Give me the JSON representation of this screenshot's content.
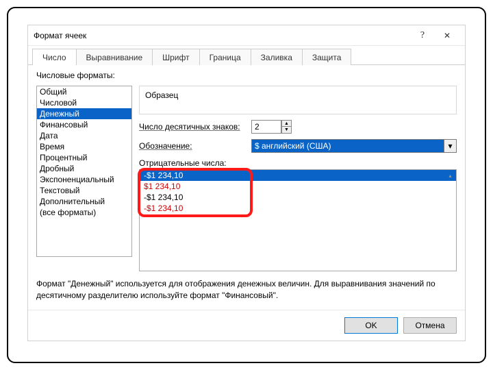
{
  "dialog": {
    "title": "Формат ячеек"
  },
  "tabs": [
    {
      "label": "Число",
      "active": true
    },
    {
      "label": "Выравнивание"
    },
    {
      "label": "Шрифт"
    },
    {
      "label": "Граница"
    },
    {
      "label": "Заливка"
    },
    {
      "label": "Защита"
    }
  ],
  "formats_label": "Числовые форматы:",
  "formats": [
    "Общий",
    "Числовой",
    "Денежный",
    "Финансовый",
    "Дата",
    "Время",
    "Процентный",
    "Дробный",
    "Экспоненциальный",
    "Текстовый",
    "Дополнительный",
    "(все форматы)"
  ],
  "formats_selected": 2,
  "sample_label": "Образец",
  "decimals": {
    "label": "Число десятичных знаков:",
    "value": "2"
  },
  "symbol": {
    "label": "Обозначение:",
    "value": "$ английский (США)"
  },
  "neg": {
    "label": "Отрицательные числа:",
    "options": [
      {
        "text": "-$1 234,10",
        "red": false,
        "selected": true
      },
      {
        "text": "$1 234,10",
        "red": true
      },
      {
        "text": "-$1 234,10",
        "red": false
      },
      {
        "text": "-$1 234,10",
        "red": true
      }
    ]
  },
  "description": "Формат \"Денежный\" используется для отображения денежных величин. Для выравнивания значений по десятичному разделителю используйте формат \"Финансовый\".",
  "buttons": {
    "ok": "OK",
    "cancel": "Отмена"
  },
  "icons": {
    "help": "?",
    "close": "✕",
    "up": "▲",
    "down": "▼",
    "dropdown": "▾",
    "scroll": "▴"
  }
}
